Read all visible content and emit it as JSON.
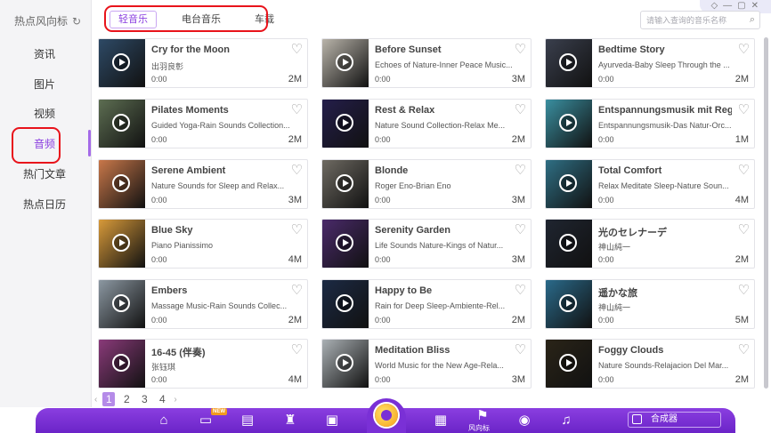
{
  "brand": {
    "title": "热点风向标",
    "refresh_icon": "refresh-icon"
  },
  "sidebar": {
    "items": [
      "资讯",
      "图片",
      "视频",
      "音频",
      "热门文章",
      "热点日历"
    ],
    "active_index": 3
  },
  "tabs": [
    "轻音乐",
    "电台音乐",
    "车载"
  ],
  "search": {
    "placeholder": "请输入查询的音乐名称"
  },
  "accent_color": "#8a3ee0",
  "tracks": [
    {
      "title": "Cry for the Moon",
      "subtitle": "出羽良彰",
      "time": "0:00",
      "size": "2M",
      "thumb": "#2e4a66"
    },
    {
      "title": "Before Sunset",
      "subtitle": "Echoes of Nature-Inner Peace Music...",
      "time": "0:00",
      "size": "3M",
      "thumb": "#b9b4aa"
    },
    {
      "title": "Bedtime Story",
      "subtitle": "Ayurveda-Baby Sleep Through the ...",
      "time": "0:00",
      "size": "2M",
      "thumb": "#3a3f4d"
    },
    {
      "title": "Pilates Moments",
      "subtitle": "Guided Yoga-Rain Sounds Collection...",
      "time": "0:00",
      "size": "2M",
      "thumb": "#5d6e52"
    },
    {
      "title": "Rest & Relax",
      "subtitle": "Nature Sound Collection-Relax Me...",
      "time": "0:00",
      "size": "2M",
      "thumb": "#241e4a"
    },
    {
      "title": "Entspannungsmusik mit Reg...",
      "subtitle": "Entspannungsmusik-Das Natur-Orc...",
      "time": "0:00",
      "size": "1M",
      "thumb": "#3a8fa0"
    },
    {
      "title": "Serene Ambient",
      "subtitle": "Nature Sounds for Sleep and Relax...",
      "time": "0:00",
      "size": "3M",
      "thumb": "#c9784a"
    },
    {
      "title": "Blonde",
      "subtitle": "Roger Eno-Brian Eno",
      "time": "0:00",
      "size": "3M",
      "thumb": "#6e6a62"
    },
    {
      "title": "Total Comfort",
      "subtitle": "Relax Meditate Sleep-Nature Soun...",
      "time": "0:00",
      "size": "4M",
      "thumb": "#2f6f84"
    },
    {
      "title": "Blue Sky",
      "subtitle": "Piano Pianissimo",
      "time": "0:00",
      "size": "4M",
      "thumb": "#d89a3a"
    },
    {
      "title": "Serenity Garden",
      "subtitle": "Life Sounds Nature-Kings of Natur...",
      "time": "0:00",
      "size": "3M",
      "thumb": "#4a2a6a"
    },
    {
      "title": "光のセレナーデ",
      "subtitle": "神山純一",
      "time": "0:00",
      "size": "2M",
      "thumb": "#1f2530"
    },
    {
      "title": "Embers",
      "subtitle": "Massage Music-Rain Sounds Collec...",
      "time": "0:00",
      "size": "2M",
      "thumb": "#8c98a2"
    },
    {
      "title": "Happy to Be",
      "subtitle": "Rain for Deep Sleep-Ambiente-Rel...",
      "time": "0:00",
      "size": "2M",
      "thumb": "#1c2a44"
    },
    {
      "title": "遥かな旅",
      "subtitle": "神山純一",
      "time": "0:00",
      "size": "5M",
      "thumb": "#2a6a8a"
    },
    {
      "title": "16-45 (伴奏)",
      "subtitle": "张钰琪",
      "time": "0:00",
      "size": "4M",
      "thumb": "#8a3a7a"
    },
    {
      "title": "Meditation Bliss",
      "subtitle": "World Music for the New Age-Rela...",
      "time": "0:00",
      "size": "3M",
      "thumb": "#aab0b4"
    },
    {
      "title": "Foggy Clouds",
      "subtitle": "Nature Sounds-Relajacion Del Mar...",
      "time": "0:00",
      "size": "2M",
      "thumb": "#2a2418"
    }
  ],
  "pagination": {
    "prev": "‹",
    "pages": [
      "1",
      "2",
      "3",
      "4"
    ],
    "current": "1",
    "next": "›"
  },
  "dock": {
    "new_badge": "NEW",
    "center_label": "风向标",
    "synthesizer_label": "合成器",
    "icons": [
      "home-icon",
      "monitor-icon",
      "document-icon",
      "money-bag-icon",
      "clipboard-icon",
      "ticket-icon",
      "weibo-icon",
      "music-icon"
    ]
  },
  "window_controls": [
    "◇",
    "—",
    "▢",
    "✕"
  ]
}
